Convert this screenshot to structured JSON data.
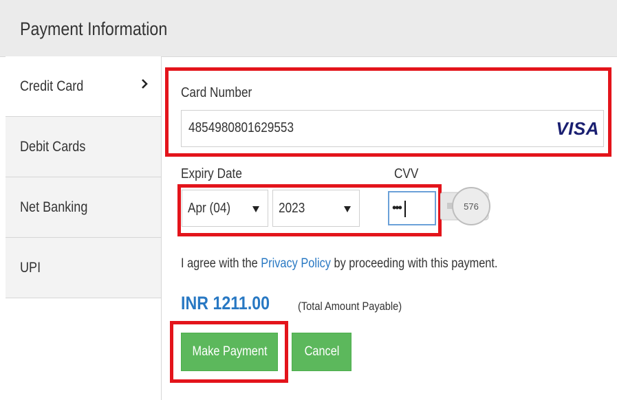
{
  "header": {
    "title": "Payment Information"
  },
  "sidebar": {
    "items": [
      {
        "label": "Credit Card",
        "active": true
      },
      {
        "label": "Debit Cards",
        "active": false
      },
      {
        "label": "Net Banking",
        "active": false
      },
      {
        "label": "UPI",
        "active": false
      }
    ]
  },
  "form": {
    "card_number_label": "Card Number",
    "card_number_value": "4854980801629553",
    "card_brand": "VISA",
    "expiry_label": "Expiry Date",
    "expiry_month": "Apr (04)",
    "expiry_year": "2023",
    "cvv_label": "CVV",
    "cvv_value": "•••",
    "cvv_hint_number": "576"
  },
  "agreement": {
    "prefix": "I agree with the ",
    "link": "Privacy Policy",
    "suffix": " by proceeding with this payment."
  },
  "amount": {
    "value": "INR 1211.00",
    "note": "(Total Amount Payable)"
  },
  "buttons": {
    "pay": "Make Payment",
    "cancel": "Cancel"
  },
  "colors": {
    "accent_blue": "#2878c3",
    "button_green": "#5cb85c",
    "highlight_red": "#e3141b",
    "visa_blue": "#1a1f71"
  }
}
